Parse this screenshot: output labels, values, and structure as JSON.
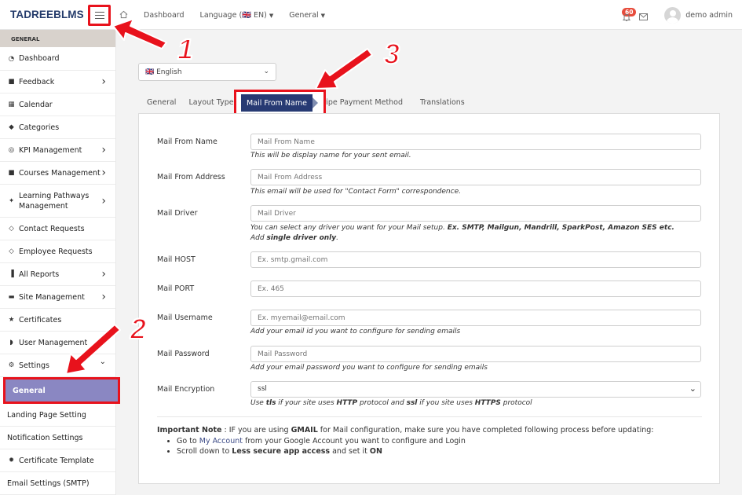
{
  "brand": {
    "name": "TADREEBLMS"
  },
  "topnav": {
    "items": [
      {
        "label": "Dashboard",
        "caret": false
      },
      {
        "label": "Language (🇬🇧 EN)",
        "caret": true
      },
      {
        "label": "General",
        "caret": true
      }
    ],
    "notification_count": "60",
    "user_name": "demo admin"
  },
  "sidebar": {
    "section": "GENERAL",
    "items": [
      {
        "label": "Dashboard",
        "icon": "dashboard-icon",
        "glyph": "◔",
        "chevron": false
      },
      {
        "label": "Feedback",
        "icon": "comments-icon",
        "glyph": "■",
        "chevron": true
      },
      {
        "label": "Calendar",
        "icon": "calendar-icon",
        "glyph": "▦",
        "chevron": false
      },
      {
        "label": "Categories",
        "icon": "tags-icon",
        "glyph": "◆",
        "chevron": false
      },
      {
        "label": "KPI Management",
        "icon": "target-icon",
        "glyph": "◎",
        "chevron": true
      },
      {
        "label": "Courses Management",
        "icon": "chat-icon",
        "glyph": "■",
        "chevron": true
      },
      {
        "label": "Learning Pathways Management",
        "icon": "puzzle-icon",
        "glyph": "✦",
        "chevron": true
      },
      {
        "label": "Contact Requests",
        "icon": "tag-icon",
        "glyph": "◇",
        "chevron": false
      },
      {
        "label": "Employee Requests",
        "icon": "tag-icon",
        "glyph": "◇",
        "chevron": false
      },
      {
        "label": "All Reports",
        "icon": "chart-icon",
        "glyph": "▐",
        "chevron": true
      },
      {
        "label": "Site Management",
        "icon": "folder-icon",
        "glyph": "▬",
        "chevron": true
      },
      {
        "label": "Certificates",
        "icon": "trophy-icon",
        "glyph": "★",
        "chevron": false
      },
      {
        "label": "User Management",
        "icon": "shield-icon",
        "glyph": "◗",
        "chevron": true
      },
      {
        "label": "Settings",
        "icon": "gear-icon",
        "glyph": "⚙",
        "chevron": true,
        "open": true
      },
      {
        "label": "General",
        "icon": "",
        "glyph": "",
        "chevron": false,
        "active": true
      },
      {
        "label": "Landing Page Setting",
        "icon": "",
        "glyph": "",
        "chevron": false
      },
      {
        "label": "Notification Settings",
        "icon": "",
        "glyph": "",
        "chevron": false
      },
      {
        "label": "Certificate Template",
        "icon": "badge-icon",
        "glyph": "✹",
        "chevron": false
      },
      {
        "label": "Email Settings (SMTP)",
        "icon": "",
        "glyph": "",
        "chevron": false
      }
    ]
  },
  "language_select": {
    "value": "🇬🇧 English"
  },
  "tabs": {
    "items": [
      "General",
      "Layout Type",
      "Mail From Name",
      "Stripe Payment Method",
      "Translations"
    ],
    "active": "Mail From Name"
  },
  "form": {
    "fields": [
      {
        "label": "Mail From Name",
        "placeholder": "Mail From Name",
        "help": "This will be display name for your sent email."
      },
      {
        "label": "Mail From Address",
        "placeholder": "Mail From Address",
        "help": "This email will be used for \"Contact Form\" correspondence."
      },
      {
        "label": "Mail Driver",
        "placeholder": "Mail Driver",
        "help1": "You can select any driver you want for your Mail setup. ",
        "help1_bold": "Ex. SMTP, Mailgun, Mandrill, SparkPost, Amazon SES etc.",
        "help2": "Add ",
        "help2_bold": "single driver only",
        "help2_end": "."
      },
      {
        "label": "Mail HOST",
        "placeholder": "Ex. smtp.gmail.com"
      },
      {
        "label": "Mail PORT",
        "placeholder": "Ex. 465"
      },
      {
        "label": "Mail Username",
        "placeholder": "Ex. myemail@email.com",
        "help": "Add your email id you want to configure for sending emails"
      },
      {
        "label": "Mail Password",
        "placeholder": "Mail Password",
        "help": "Add your email password you want to configure for sending emails"
      },
      {
        "label": "Mail Encryption",
        "value": "ssl",
        "help_a": "Use ",
        "help_b": "tls",
        "help_c": " if your site uses ",
        "help_d": "HTTP",
        "help_e": " protocol and ",
        "help_f": "ssl",
        "help_g": " if you site uses ",
        "help_h": "HTTPS",
        "help_i": " protocol"
      }
    ]
  },
  "note": {
    "title": "Important Note",
    "text_a": " : IF you are using ",
    "text_b": "GMAIL",
    "text_c": " for Mail configuration, make sure you have completed following process before updating:",
    "bullet1_a": "Go to ",
    "bullet1_link": "My Account",
    "bullet1_b": " from your Google Account you want to configure and Login",
    "bullet2_a": "Scroll down to ",
    "bullet2_b": "Less secure app access",
    "bullet2_c": " and set it ",
    "bullet2_d": "ON"
  },
  "annotations": {
    "n1": "1",
    "n2": "2",
    "n3": "3"
  },
  "colors": {
    "accent": "#273a73",
    "annotation": "#e8121c",
    "active_sidebar": "#8a87c2",
    "badge": "#e74c3c"
  }
}
